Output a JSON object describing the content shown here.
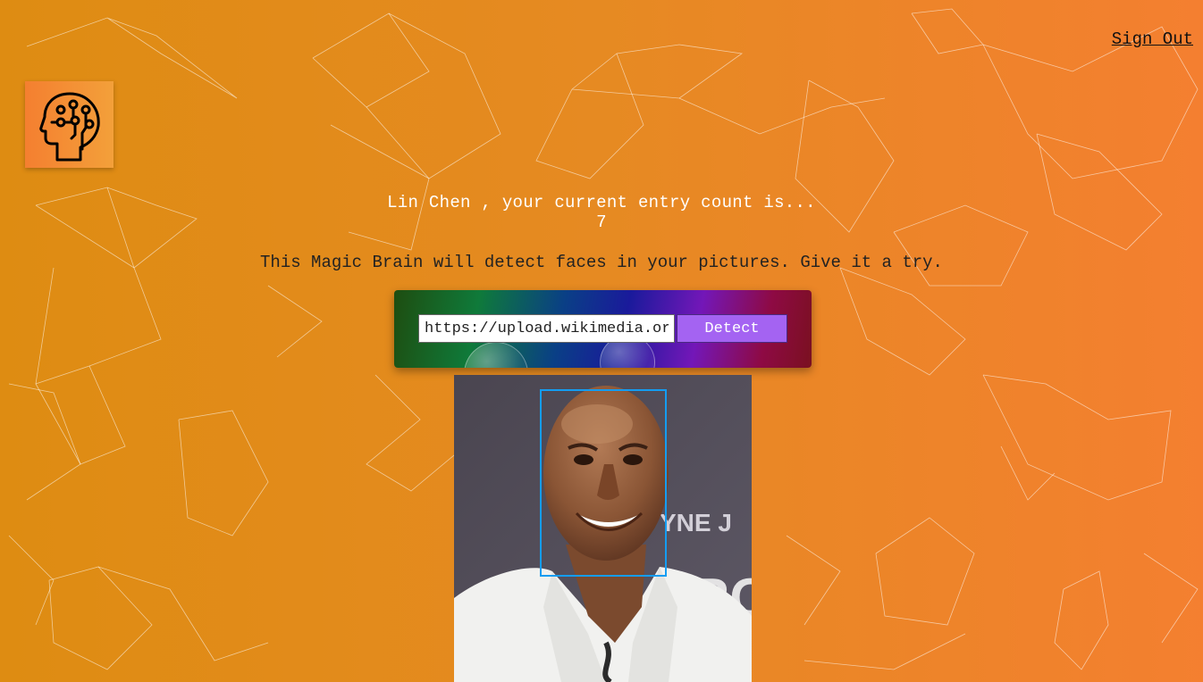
{
  "nav": {
    "sign_out_label": "Sign Out"
  },
  "logo": {
    "icon": "brain-head-icon"
  },
  "rank": {
    "message": "Lin Chen , your current entry count is...",
    "entries": "7"
  },
  "intro": {
    "text": "This Magic Brain will detect faces in your pictures. Give it a try."
  },
  "form": {
    "url_value": "https://upload.wikimedia.org/",
    "detect_label": "Detect"
  },
  "result": {
    "image_alt": "face-photo",
    "box_color": "#149df2"
  },
  "colors": {
    "background_start": "#de8c12",
    "background_end": "#f47f30",
    "button": "#a463f2"
  }
}
